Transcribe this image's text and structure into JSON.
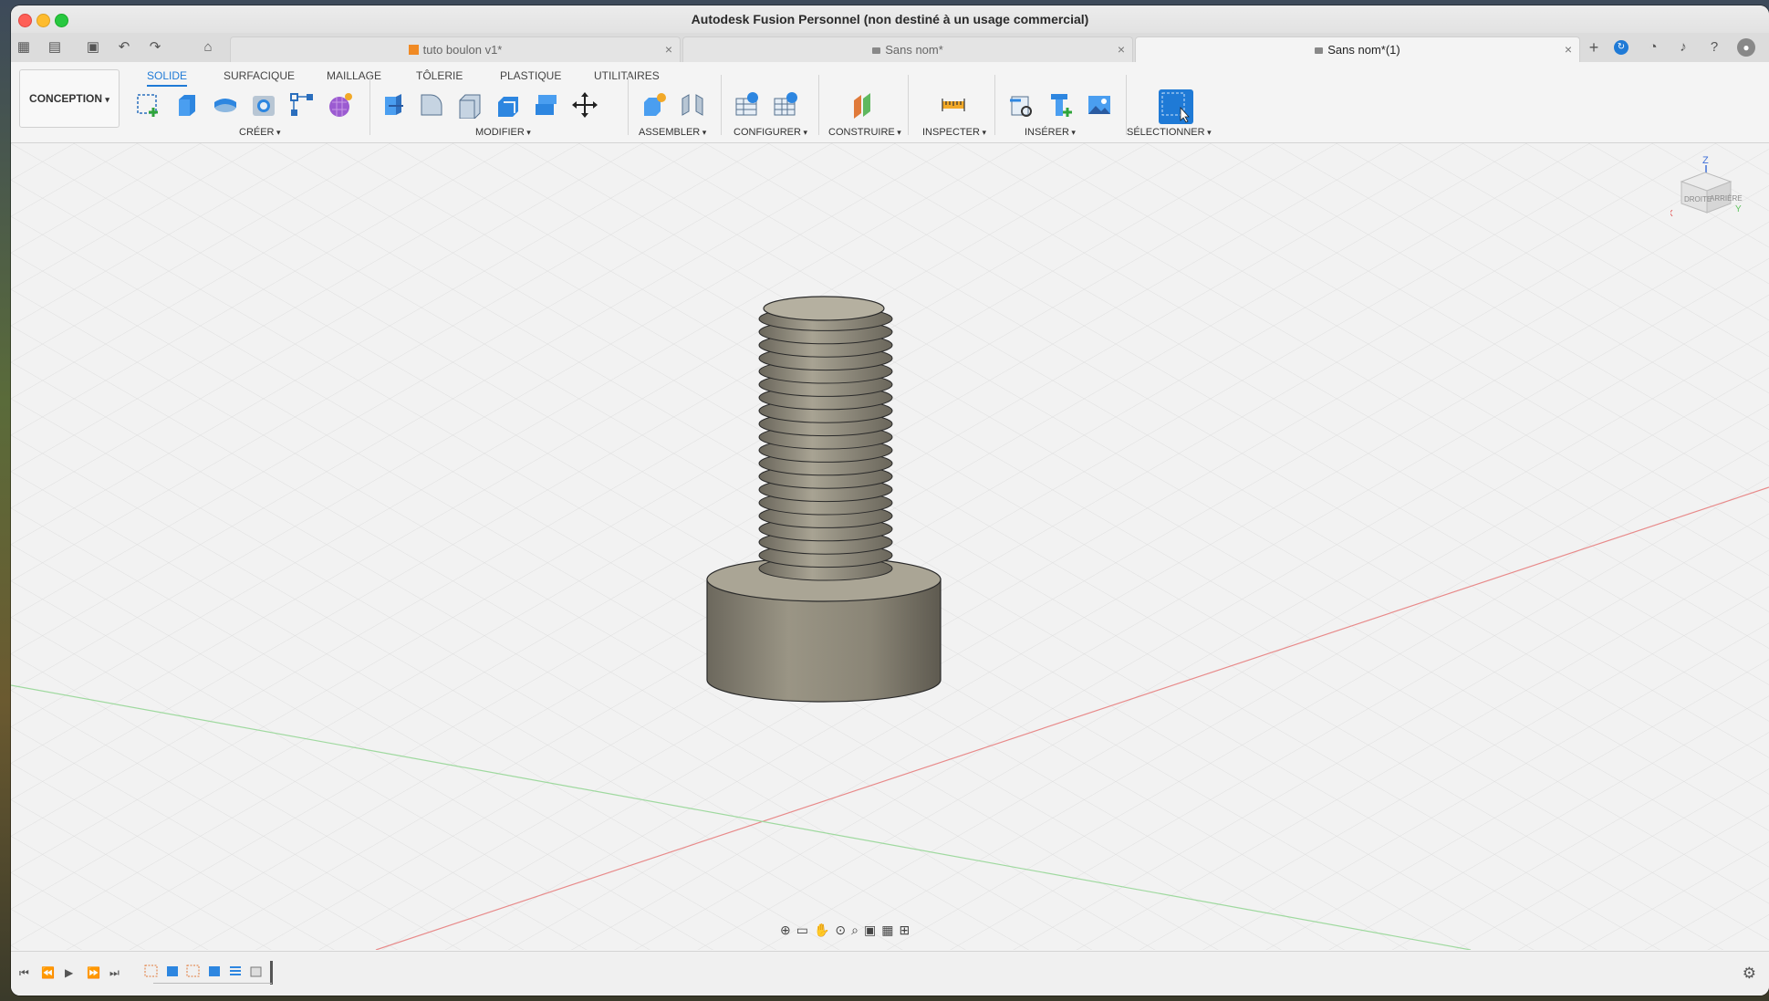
{
  "window": {
    "title": "Autodesk Fusion Personnel (non destiné à un usage commercial)"
  },
  "tabs": [
    {
      "label": "tuto boulon v1*",
      "active": false
    },
    {
      "label": "Sans nom*",
      "active": false
    },
    {
      "label": "Sans nom*(1)",
      "active": true
    }
  ],
  "workspace": {
    "label": "CONCEPTION"
  },
  "ribbon": {
    "tabs": [
      "SOLIDE",
      "SURFACIQUE",
      "MAILLAGE",
      "TÔLERIE",
      "PLASTIQUE",
      "UTILITAIRES"
    ],
    "active_tab": "SOLIDE",
    "groups": [
      "CRÉER",
      "MODIFIER",
      "ASSEMBLER",
      "CONFIGURER",
      "CONSTRUIRE",
      "INSPECTER",
      "INSÉRER",
      "SÉLECTIONNER"
    ]
  },
  "viewcube": {
    "top": "Z",
    "left_face": "DROITE",
    "right_face": "ARRIÈRE",
    "x_axis": "X",
    "y_axis": "Y"
  },
  "colors": {
    "accent": "#1f7ad6",
    "x_axis": "#e05050",
    "y_axis": "#5fc45f",
    "z_axis": "#3f6fd8",
    "model": "#8a8576"
  }
}
